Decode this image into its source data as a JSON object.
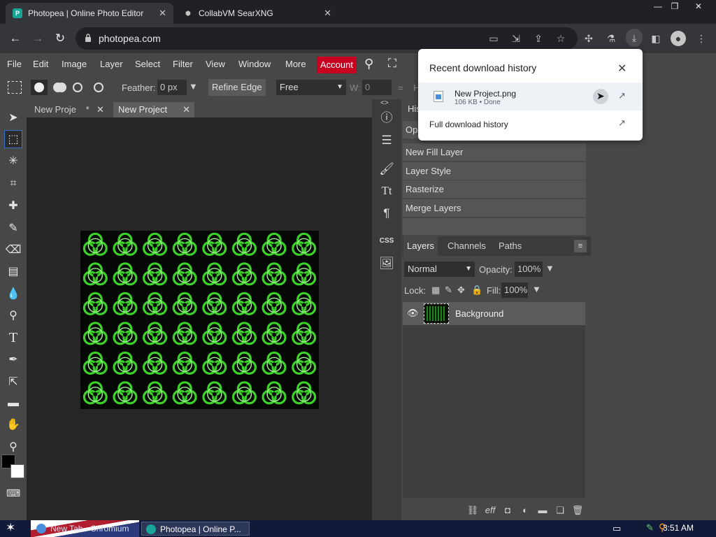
{
  "browser": {
    "tabs": [
      {
        "title": "Photopea | Online Photo Editor",
        "active": true
      },
      {
        "title": "CollabVM SearXNG",
        "active": false
      }
    ],
    "url": "photopea.com",
    "window_controls": {
      "minimize": "—",
      "restore": "❐",
      "close": "✕"
    }
  },
  "menubar": {
    "items": [
      "File",
      "Edit",
      "Image",
      "Layer",
      "Select",
      "Filter",
      "View",
      "Window",
      "More"
    ],
    "account": "Account"
  },
  "options": {
    "feather_label": "Feather:",
    "feather_value": "0 px",
    "refine_edge": "Refine Edge",
    "style_value": "Free",
    "w_label": "W:",
    "w_value": "0",
    "eq": "=",
    "h_label": "H"
  },
  "documents": {
    "tabs": [
      {
        "label": "New Proje",
        "modified": "*"
      },
      {
        "label": "New Project",
        "modified": ""
      }
    ]
  },
  "history": {
    "items": [
      "New Fill Layer",
      "Layer Style",
      "Rasterize",
      "Merge Layers"
    ],
    "partial_tab": "His",
    "partial_row": "Op"
  },
  "layers_panel": {
    "tabs": [
      "Layers",
      "Channels",
      "Paths"
    ],
    "blend_mode": "Normal",
    "opacity_label": "Opacity:",
    "opacity_value": "100%",
    "lock_label": "Lock:",
    "fill_label": "Fill:",
    "fill_value": "100%",
    "layers": [
      {
        "name": "Background",
        "visible": true
      }
    ]
  },
  "icon_strip": {
    "css_label": "CSS"
  },
  "download_popup": {
    "title": "Recent download history",
    "file_name": "New Project.png",
    "file_meta": "106 KB • Done",
    "full_history": "Full download history"
  },
  "taskbar": {
    "tasks": [
      "New Tab - Chromium",
      "Photopea | Online P..."
    ],
    "time": "3:51 AM"
  },
  "colors": {
    "account_red": "#c8001f",
    "canvas_green": "#3cd22a",
    "selection_blue": "#3a74c8",
    "taskbar": "#121a3a"
  }
}
